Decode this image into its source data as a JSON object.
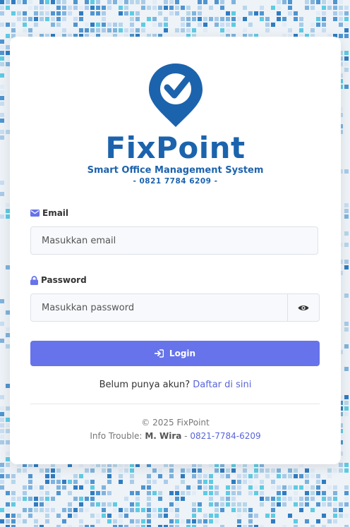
{
  "brand": {
    "name": "FixPoint",
    "tagline": "Smart Office Management System",
    "phone": "- 0821 7784 6209 -"
  },
  "form": {
    "email_label": "Email",
    "email_placeholder": "Masukkan email",
    "password_label": "Password",
    "password_placeholder": "Masukkan password",
    "login_label": "Login"
  },
  "register": {
    "prompt": "Belum punya akun?",
    "link_label": "Daftar di sini"
  },
  "footer": {
    "copyright": "© 2025 FixPoint",
    "trouble_prefix": "Info Trouble:",
    "contact_name": "M. Wira",
    "separator": " - ",
    "contact_phone": "0821-7784-6209"
  },
  "colors": {
    "brand_blue": "#1c63ad",
    "button": "#6673ea",
    "link": "#5865d8"
  },
  "icons": [
    "map-pin-check-icon",
    "envelope-icon",
    "lock-icon",
    "eye-icon",
    "sign-in-icon"
  ]
}
